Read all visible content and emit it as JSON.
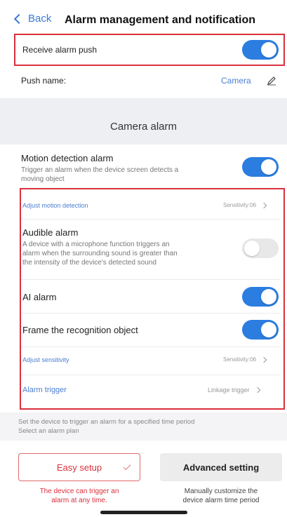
{
  "header": {
    "back_label": "Back",
    "title": "Alarm management and notification"
  },
  "receive_push": {
    "label": "Receive alarm push",
    "on": true
  },
  "push_name": {
    "label": "Push name:",
    "value": "Camera"
  },
  "camera_section": {
    "title": "Camera alarm"
  },
  "motion_detection": {
    "label": "Motion detection alarm",
    "description_1": "Trigger an alarm when the device screen detects a",
    "description_2": "moving object",
    "on": true
  },
  "adjust_motion": {
    "label": "Adjust motion detection",
    "value": "Sensitivity:06"
  },
  "audible_alarm": {
    "label": "Audible alarm",
    "description_1": "A device with a microphone function triggers an",
    "description_2": "alarm when the surrounding sound is greater than",
    "description_3": "the intensity of the device's detected sound",
    "on": false
  },
  "ai_alarm": {
    "label": "AI alarm",
    "on": true
  },
  "frame_object": {
    "label": "Frame the recognition object",
    "on": true
  },
  "adjust_sensitivity": {
    "label": "Adjust sensitivity",
    "value": "Sensitivity:06"
  },
  "alarm_trigger": {
    "label": "Alarm trigger",
    "value": "Linkage trigger"
  },
  "plan_hint": {
    "line_1": "Set the device to trigger an alarm for a specified time period",
    "line_2": "Select an alarm plan"
  },
  "easy_setup": {
    "label": "Easy setup",
    "caption_1": "The device can trigger an",
    "caption_2": "alarm at any time."
  },
  "advanced_setting": {
    "label": "Advanced setting",
    "caption_1": "Manually customize the",
    "caption_2": "device alarm time period"
  },
  "colors": {
    "accent": "#2b7de0",
    "highlight": "#d9303c",
    "section_bg": "#eeeff2"
  }
}
